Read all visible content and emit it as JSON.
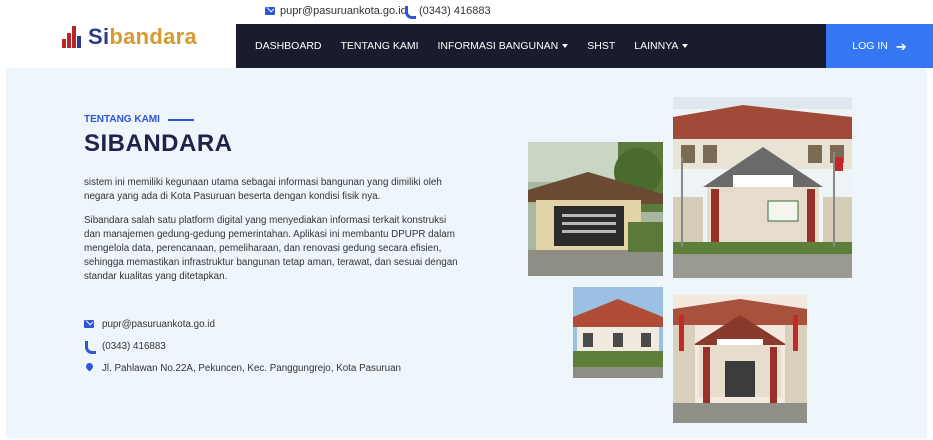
{
  "topbar": {
    "email": "pupr@pasuruankota.go.id",
    "phone": "(0343) 416883"
  },
  "brand": {
    "name_prefix": "Si",
    "name_suffix": "bandara"
  },
  "nav": {
    "items": [
      {
        "label": "DASHBOARD",
        "dropdown": false
      },
      {
        "label": "TENTANG KAMI",
        "dropdown": false
      },
      {
        "label": "INFORMASI BANGUNAN",
        "dropdown": true
      },
      {
        "label": "SHST",
        "dropdown": false
      },
      {
        "label": "LAINNYA",
        "dropdown": true
      }
    ],
    "login_label": "LOG IN",
    "login_icon": "arrow-right-icon"
  },
  "about": {
    "eyebrow": "TENTANG KAMI",
    "title": "SIBANDARA",
    "paragraph1": "sistem ini memiliki kegunaan utama sebagai informasi bangunan yang dimiliki oleh negara yang ada di Kota Pasuruan beserta dengan kondisi fisik nya.",
    "paragraph2": "Sibandara salah satu platform digital yang menyediakan informasi terkait konstruksi dan manajemen gedung-gedung pemerintahan. Aplikasi ini membantu DPUPR dalam mengelola data, perencanaan, pemeliharaan, dan renovasi gedung secara efisien, sehingga memastikan infrastruktur bangunan tetap aman, terawat, dan sesuai dengan standar kualitas yang ditetapkan.",
    "contact": {
      "email": "pupr@pasuruankota.go.id",
      "phone": "(0343) 416883",
      "address": "Jl. Pahlawan No.22A, Pekuncen, Kec. Panggungrejo, Kota Pasuruan"
    }
  },
  "colors": {
    "accent": "#2f56d6",
    "navbar_bg": "#191c2d",
    "login_bg": "#3576f3",
    "section_bg": "#eef5fb",
    "heading": "#1d2449",
    "logo_gold": "#d59a31"
  }
}
